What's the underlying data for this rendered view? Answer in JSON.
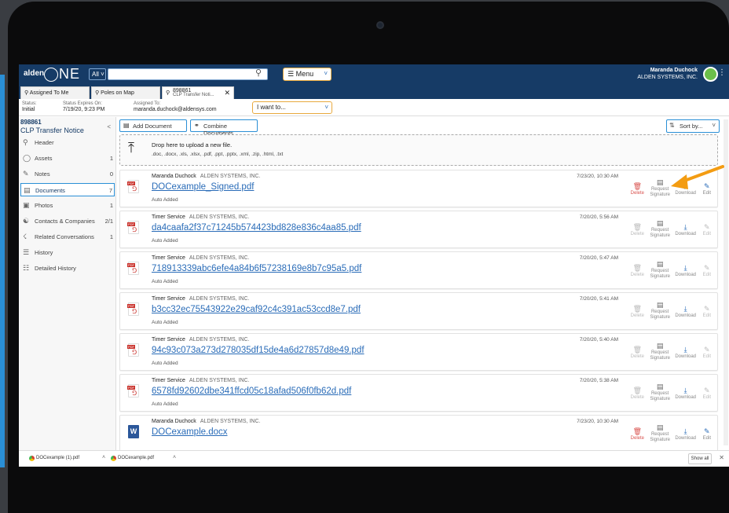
{
  "app": {
    "logo_alden": "alden",
    "logo_one": "NE",
    "search_scope": "All",
    "search_placeholder": "",
    "menu_label": "Menu",
    "user_name": "Maranda Duchock",
    "user_company": "ALDEN SYSTEMS, INC."
  },
  "tabs": [
    {
      "label": "Assigned To Me"
    },
    {
      "label": "Poles on Map"
    },
    {
      "label": "898861",
      "sub": "CLP Transfer Noti..."
    }
  ],
  "status": {
    "status_label": "Status:",
    "status_value": "Initial",
    "expires_label": "Status Expires On:",
    "expires_value": "7/19/20, 9:23 PM",
    "assigned_label": "Assigned To:",
    "assigned_value": "maranda.duchock@aldensys.com",
    "iwant_label": "I want to..."
  },
  "sidebar": {
    "record_id": "898861",
    "record_title": "CLP Transfer Notice",
    "items": [
      {
        "label": "Header",
        "count": ""
      },
      {
        "label": "Assets",
        "count": "1"
      },
      {
        "label": "Notes",
        "count": "0"
      },
      {
        "label": "Documents",
        "count": "7"
      },
      {
        "label": "Photos",
        "count": "1"
      },
      {
        "label": "Contacts & Companies",
        "count": "2/1"
      },
      {
        "label": "Related Conversations",
        "count": "1"
      },
      {
        "label": "History",
        "count": ""
      },
      {
        "label": "Detailed History",
        "count": ""
      }
    ]
  },
  "toolbar": {
    "add_document": "Add Document",
    "combine_documents": "Combine Documents",
    "sort_by": "Sort by..."
  },
  "dropzone": {
    "title": "Drop here to upload a new file.",
    "types": ".doc, .docx, .xls, .xlsx, .pdf, .ppt, .pptx, .xml, .zip, .html, .txt"
  },
  "actions": {
    "delete": "Delete",
    "request": "Request",
    "signature": "Signature",
    "download": "Download",
    "edit": "Edit"
  },
  "documents": [
    {
      "author": "Maranda Duchock",
      "company": "ALDEN SYSTEMS, INC.",
      "file": "DOCexample_Signed.pdf",
      "note": "Auto Added",
      "date": "7/23/20, 10:30 AM",
      "type": "pdf",
      "deletable": true
    },
    {
      "author": "Timer Service",
      "company": "ALDEN SYSTEMS, INC.",
      "file": "da4caafa2f37c71245b574423bd828e836c4aa85.pdf",
      "note": "Auto Added",
      "date": "7/20/20, 5:56 AM",
      "type": "pdf",
      "deletable": false
    },
    {
      "author": "Timer Service",
      "company": "ALDEN SYSTEMS, INC.",
      "file": "718913339abc6efe4a84b6f57238169e8b7c95a5.pdf",
      "note": "Auto Added",
      "date": "7/20/20, 5:47 AM",
      "type": "pdf",
      "deletable": false
    },
    {
      "author": "Timer Service",
      "company": "ALDEN SYSTEMS, INC.",
      "file": "b3cc32ec75543922e29caf92c4c391ac53ccd8e7.pdf",
      "note": "Auto Added",
      "date": "7/20/20, 5:41 AM",
      "type": "pdf",
      "deletable": false
    },
    {
      "author": "Timer Service",
      "company": "ALDEN SYSTEMS, INC.",
      "file": "94c93c073a273d278035df15de4a6d27857d8e49.pdf",
      "note": "Auto Added",
      "date": "7/20/20, 5:40 AM",
      "type": "pdf",
      "deletable": false
    },
    {
      "author": "Timer Service",
      "company": "ALDEN SYSTEMS, INC.",
      "file": "6578fd92602dbe341ffcd05c18afad506f0fb62d.pdf",
      "note": "Auto Added",
      "date": "7/20/20, 5:38 AM",
      "type": "pdf",
      "deletable": false
    },
    {
      "author": "Maranda Duchock",
      "company": "ALDEN SYSTEMS, INC.",
      "file": "DOCexample.docx",
      "note": "",
      "date": "7/23/20, 10:30 AM",
      "type": "word",
      "deletable": true
    }
  ],
  "downloads": {
    "items": [
      {
        "label": "DOCexample (1).pdf"
      },
      {
        "label": "DOCexample.pdf"
      }
    ],
    "show_all": "Show all"
  },
  "colors": {
    "header": "#163b66",
    "accent": "#2a8fd6",
    "highlight": "#e8a93e",
    "arrow": "#f39c12"
  }
}
